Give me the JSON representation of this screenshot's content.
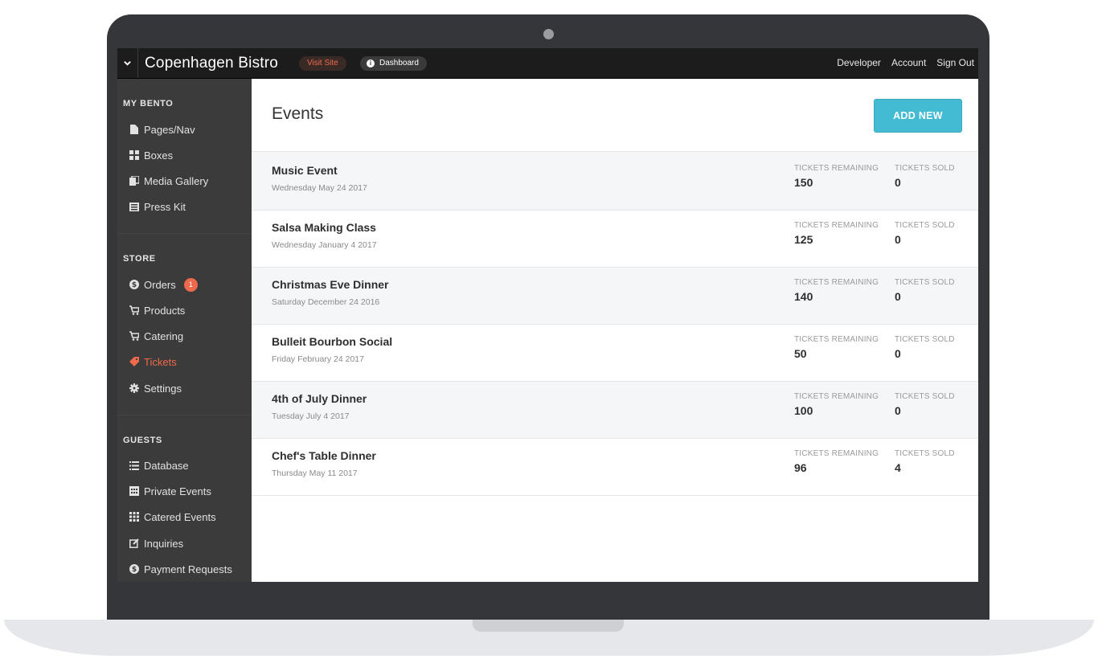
{
  "topbar": {
    "site_name": "Copenhagen Bistro",
    "visit_site": "Visit Site",
    "dashboard": "Dashboard",
    "links": [
      "Developer",
      "Account",
      "Sign Out"
    ]
  },
  "sidebar": {
    "sections": [
      {
        "title": "MY BENTO",
        "items": [
          {
            "label": "Pages/Nav",
            "icon": "page-icon"
          },
          {
            "label": "Boxes",
            "icon": "grid-icon"
          },
          {
            "label": "Media Gallery",
            "icon": "media-icon"
          },
          {
            "label": "Press Kit",
            "icon": "newspaper-icon"
          }
        ]
      },
      {
        "title": "STORE",
        "items": [
          {
            "label": "Orders",
            "icon": "dollar-icon",
            "badge": "1"
          },
          {
            "label": "Products",
            "icon": "cart-icon"
          },
          {
            "label": "Catering",
            "icon": "cart-icon"
          },
          {
            "label": "Tickets",
            "icon": "tag-icon",
            "active": true
          },
          {
            "label": "Settings",
            "icon": "gear-icon"
          }
        ]
      },
      {
        "title": "GUESTS",
        "items": [
          {
            "label": "Database",
            "icon": "list-icon"
          },
          {
            "label": "Private Events",
            "icon": "calendar-icon"
          },
          {
            "label": "Catered Events",
            "icon": "grid-icon"
          },
          {
            "label": "Inquiries",
            "icon": "edit-icon"
          },
          {
            "label": "Payment Requests",
            "icon": "dollar-icon"
          }
        ]
      }
    ]
  },
  "main": {
    "title": "Events",
    "add_new": "ADD NEW",
    "col_remaining": "TICKETS REMAINING",
    "col_sold": "TICKETS SOLD",
    "events": [
      {
        "name": "Music Event",
        "date": "Wednesday May 24 2017",
        "remaining": "150",
        "sold": "0"
      },
      {
        "name": "Salsa Making Class",
        "date": "Wednesday January 4 2017",
        "remaining": "125",
        "sold": "0"
      },
      {
        "name": "Christmas Eve Dinner",
        "date": "Saturday December 24 2016",
        "remaining": "140",
        "sold": "0"
      },
      {
        "name": "Bulleit Bourbon Social",
        "date": "Friday February 24 2017",
        "remaining": "50",
        "sold": "0"
      },
      {
        "name": "4th of July Dinner",
        "date": "Tuesday July 4 2017",
        "remaining": "100",
        "sold": "0"
      },
      {
        "name": "Chef's Table Dinner",
        "date": "Thursday May 11 2017",
        "remaining": "96",
        "sold": "4"
      }
    ]
  },
  "colors": {
    "accent": "#ef6a4c",
    "button": "#43bbd3",
    "sidebar": "#3b3b3b",
    "topbar": "#1c1c1c"
  }
}
